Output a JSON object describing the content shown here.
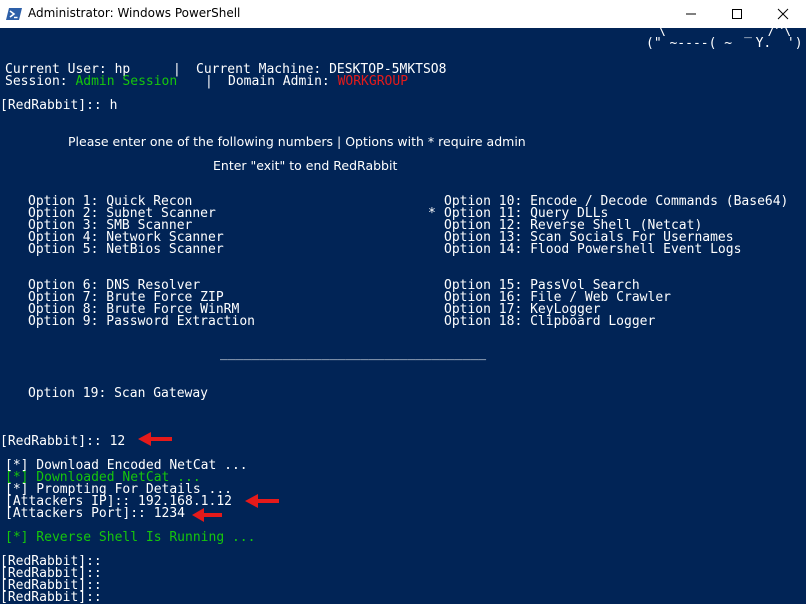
{
  "window": {
    "title": "Administrator: Windows PowerShell",
    "accent": "#012456"
  },
  "console": {
    "ascii_art": [
      "\\          _  /^\\",
      "(\" ~----( ~   Y.  ')"
    ],
    "status": {
      "user_label": "Current User:",
      "user": "hp",
      "machine_label": "Current Machine:",
      "machine": "DESKTOP-5MKTSO8",
      "session_label": "Session:",
      "session": "Admin Session",
      "domain_label": "Domain Admin:",
      "domain": "WORKGROUP",
      "separator": "|"
    },
    "prompt": "[RedRabbit]::",
    "first_command": "h",
    "help_line1": "Please enter one of the following numbers | Options with * require admin",
    "help_line2": "Enter \"exit\" to end RedRabbit",
    "options_left": [
      "Option 1: Quick Recon",
      "Option 2: Subnet Scanner",
      "Option 3: SMB Scanner",
      "Option 4: Network Scanner",
      "Option 5: NetBios Scanner",
      "Option 6: DNS Resolver",
      "Option 7: Brute Force ZIP",
      "Option 8: Brute Force WinRM",
      "Option 9: Password Extraction"
    ],
    "options_right": [
      "Option 10: Encode / Decode Commands (Base64)",
      "Option 11: Query DLLs",
      "Option 12: Reverse Shell (Netcat)",
      "Option 13: Scan Socials For Usernames",
      "Option 14: Flood Powershell Event Logs",
      "Option 15: PassVol Search",
      "Option 16: File / Web Crawler",
      "Option 17: KeyLogger",
      "Option 18: Clipboard Logger"
    ],
    "admin_marker": "*",
    "divider": "__________________________________",
    "option19": "Option 19: Scan Gateway",
    "selected_option": "12",
    "log": [
      "[*] Download Encoded NetCat ...",
      "[*] Downloaded NetCat ...",
      "[*] Prompting For Details ...",
      "[Attackers IP]:: 192.168.1.12",
      "[Attackers Port]:: 1234"
    ],
    "running": "[*] Reverse Shell Is Running ...",
    "trailing_prompts": [
      "[RedRabbit]::",
      "[RedRabbit]::",
      "[RedRabbit]::",
      "[RedRabbit]::"
    ]
  },
  "colors": {
    "background": "#012456",
    "text": "#ffffff",
    "green": "#16c60c",
    "red": "#e31b1b"
  },
  "icons": {
    "app": "powershell-icon",
    "minimize": "minimize-icon",
    "maximize": "maximize-icon",
    "close": "close-icon",
    "annotation": "red-arrow-icon"
  }
}
